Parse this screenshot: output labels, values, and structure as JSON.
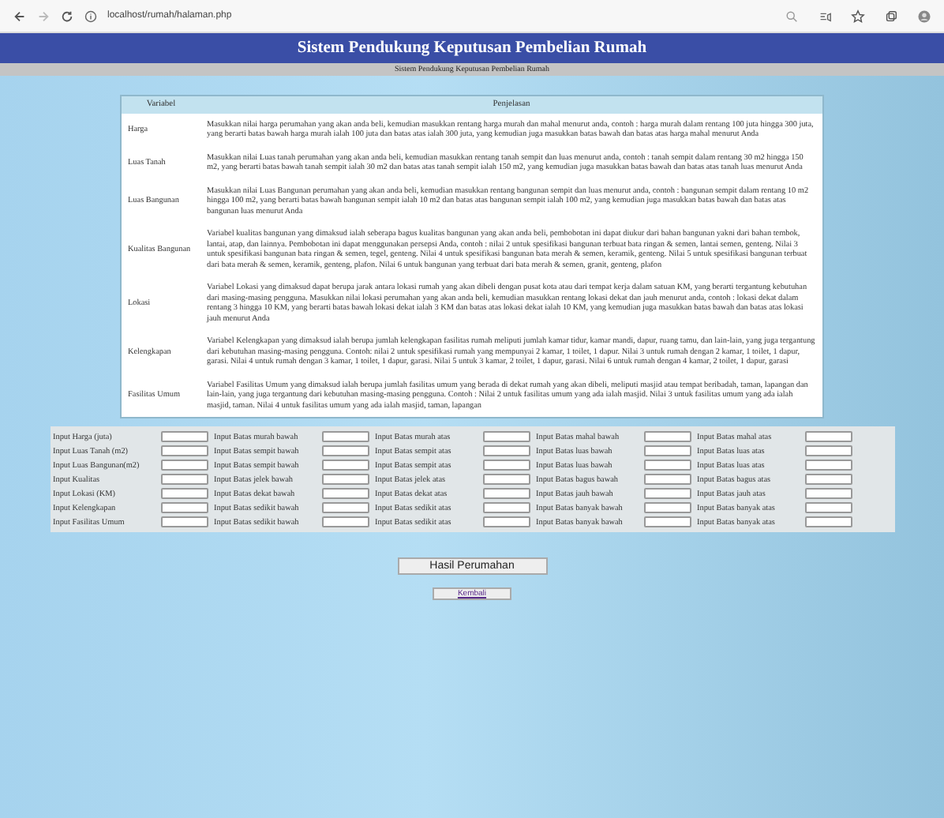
{
  "browser": {
    "url": "localhost/rumah/halaman.php"
  },
  "header": {
    "title": "Sistem Pendukung Keputusan Pembelian Rumah",
    "subtitle": "Sistem Pendukung Keputusan Pembelian Rumah"
  },
  "table": {
    "columns": [
      "Variabel",
      "Penjelasan"
    ],
    "rows": [
      {
        "variable": "Harga",
        "description": "Masukkan nilai harga perumahan yang akan anda beli, kemudian masukkan rentang harga murah dan mahal menurut anda, contoh : harga murah dalam rentang 100 juta hingga 300 juta, yang berarti batas bawah harga murah ialah 100 juta dan batas atas ialah 300 juta, yang kemudian juga masukkan batas bawah dan batas atas harga mahal menurut Anda"
      },
      {
        "variable": "Luas Tanah",
        "description": "Masukkan nilai Luas tanah perumahan yang akan anda beli, kemudian masukkan rentang tanah sempit dan luas menurut anda, contoh : tanah sempit dalam rentang 30 m2 hingga 150 m2, yang berarti batas bawah tanah sempit ialah 30 m2 dan batas atas tanah sempit ialah 150 m2, yang kemudian juga masukkan batas bawah dan batas atas tanah luas menurut Anda"
      },
      {
        "variable": "Luas Bangunan",
        "description": "Masukkan nilai Luas Bangunan perumahan yang akan anda beli, kemudian masukkan rentang bangunan sempit dan luas menurut anda, contoh : bangunan sempit dalam rentang 10 m2 hingga 100 m2, yang berarti batas bawah bangunan sempit ialah 10 m2 dan batas atas bangunan sempit ialah 100 m2, yang kemudian juga masukkan batas bawah dan batas atas bangunan luas menurut Anda"
      },
      {
        "variable": "Kualitas Bangunan",
        "description": "Variabel kualitas bangunan yang dimaksud ialah seberapa bagus kualitas bangunan yang akan anda beli, pembobotan ini dapat diukur dari bahan bangunan yakni dari bahan tembok, lantai, atap, dan lainnya. Pembobotan ini dapat menggunakan persepsi Anda, contoh : nilai 2 untuk spesifikasi bangunan terbuat bata ringan & semen, lantai semen, genteng. Nilai 3 untuk spesifikasi bangunan bata ringan & semen, tegel, genteng. Nilai 4 untuk spesifikasi bangunan bata merah & semen, keramik, genteng. Nilai 5 untuk spesifikasi bangunan terbuat dari bata merah & semen, keramik, genteng, plafon. Nilai 6 untuk bangunan yang terbuat dari bata merah & semen, granit, genteng, plafon"
      },
      {
        "variable": "Lokasi",
        "description": "Variabel Lokasi yang dimaksud dapat berupa jarak antara lokasi rumah yang akan dibeli dengan pusat kota atau dari tempat kerja dalam satuan KM, yang berarti tergantung kebutuhan dari masing-masing pengguna. Masukkan nilai lokasi perumahan yang akan anda beli, kemudian masukkan rentang lokasi dekat dan jauh menurut anda, contoh : lokasi dekat dalam rentang 3 hingga 10 KM, yang berarti batas bawah lokasi dekat ialah 3 KM dan batas atas lokasi dekat ialah 10 KM, yang kemudian juga masukkan batas bawah dan batas atas lokasi jauh menurut Anda"
      },
      {
        "variable": "Kelengkapan",
        "description": "Variabel Kelengkapan yang dimaksud ialah berupa jumlah kelengkapan fasilitas rumah meliputi jumlah kamar tidur, kamar mandi, dapur, ruang tamu, dan lain-lain, yang juga tergantung dari kebutuhan masing-masing pengguna. Contoh: nilai 2 untuk spesifikasi rumah yang mempunyai 2 kamar, 1 toilet, 1 dapur. Nilai 3 untuk rumah dengan 2 kamar, 1 toilet, 1 dapur, garasi. Nilai 4 untuk rumah dengan 3 kamar, 1 toilet, 1 dapur, garasi. Nilai 5 untuk 3 kamar, 2 toilet, 1 dapur, garasi. Nilai 6 untuk rumah dengan 4 kamar, 2 toilet, 1 dapur, garasi"
      },
      {
        "variable": "Fasilitas Umum",
        "description": "Variabel Fasilitas Umum yang dimaksud ialah berupa jumlah fasilitas umum yang berada di dekat rumah yang akan dibeli, meliputi masjid atau tempat beribadah, taman, lapangan dan lain-lain, yang juga tergantung dari kebutuhan masing-masing pengguna. Contoh : Nilai 2 untuk fasilitas umum yang ada ialah masjid. Nilai 3 untuk fasilitas umum yang ada ialah masjid, taman. Nilai 4 untuk fasilitas umum yang ada ialah masjid, taman, lapangan"
      }
    ]
  },
  "form": {
    "rows": [
      [
        "Input Harga (juta)",
        "Input Batas murah bawah",
        "Input Batas murah atas",
        "Input Batas mahal bawah",
        "Input Batas mahal atas"
      ],
      [
        "Input Luas Tanah (m2)",
        "Input Batas sempit bawah",
        "Input Batas sempit atas",
        "Input Batas luas bawah",
        "Input Batas luas atas"
      ],
      [
        "Input Luas Bangunan(m2)",
        "Input Batas sempit bawah",
        "Input Batas sempit atas",
        "Input Batas luas bawah",
        "Input Batas luas atas"
      ],
      [
        "Input Kualitas",
        "Input Batas jelek bawah",
        "Input Batas jelek atas",
        "Input Batas bagus bawah",
        "Input Batas bagus atas"
      ],
      [
        "Input Lokasi (KM)",
        "Input Batas dekat bawah",
        "Input Batas dekat atas",
        "Input Batas jauh bawah",
        "Input Batas jauh atas"
      ],
      [
        "Input Kelengkapan",
        "Input Batas sedikit bawah",
        "Input Batas sedikit atas",
        "Input Batas banyak bawah",
        "Input Batas banyak atas"
      ],
      [
        "Input Fasilitas Umum",
        "Input Batas sedikit bawah",
        "Input Batas sedikit atas",
        "Input Batas banyak bawah",
        "Input Batas banyak atas"
      ]
    ]
  },
  "submit_button": "Hasil Perumahan",
  "back_link": "Kembali"
}
